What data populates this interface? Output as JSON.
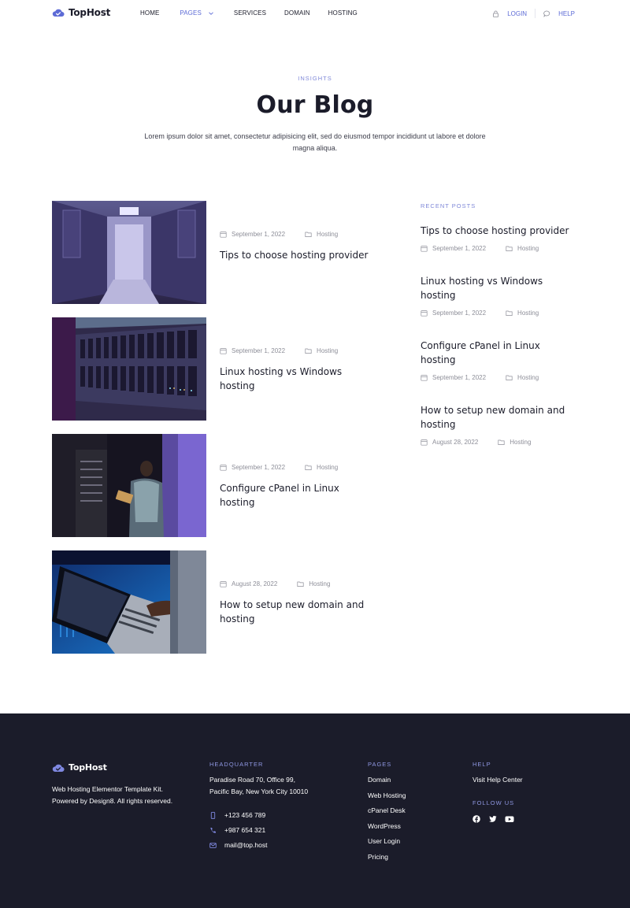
{
  "brand": {
    "name": "TopHost",
    "accent": "#5d6bd6",
    "dark": "#1b1c2a"
  },
  "nav": {
    "items": [
      {
        "label": "HOME"
      },
      {
        "label": "PAGES"
      },
      {
        "label": "SERVICES"
      },
      {
        "label": "DOMAIN"
      },
      {
        "label": "HOSTING"
      }
    ],
    "login_label": "LOGIN",
    "help_label": "HELP"
  },
  "hero": {
    "eyebrow": "INSIGHTS",
    "title": "Our Blog",
    "lead": "Lorem ipsum dolor sit amet, consectetur adipisicing elit, sed do eiusmod tempor incididunt ut labore et dolore magna aliqua."
  },
  "posts": [
    {
      "date": "September 1, 2022",
      "category": "Hosting",
      "title": "Tips to choose hosting provider",
      "image": "server-corridor"
    },
    {
      "date": "September 1, 2022",
      "category": "Hosting",
      "title": "Linux hosting vs Windows hosting",
      "image": "server-rack"
    },
    {
      "date": "September 1, 2022",
      "category": "Hosting",
      "title": "Configure cPanel in Linux hosting",
      "image": "engineer-tablet"
    },
    {
      "date": "August 28, 2022",
      "category": "Hosting",
      "title": "How to setup new domain and hosting",
      "image": "laptop-datacenter"
    }
  ],
  "sidebar": {
    "eyebrow": "RECENT POSTS",
    "posts": [
      {
        "title": "Tips to choose hosting provider",
        "date": "September 1, 2022",
        "category": "Hosting"
      },
      {
        "title": "Linux hosting vs Windows hosting",
        "date": "September 1, 2022",
        "category": "Hosting"
      },
      {
        "title": "Configure cPanel in Linux hosting",
        "date": "September 1, 2022",
        "category": "Hosting"
      },
      {
        "title": "How to setup new domain and hosting",
        "date": "August 28, 2022",
        "category": "Hosting"
      }
    ]
  },
  "footer": {
    "brand": "TopHost",
    "description": "Web Hosting Elementor Template Kit. Powered by Design8. All rights reserved.",
    "hq_title": "HEADQUARTER",
    "address_line1": "Paradise Road 70, Office 99,",
    "address_line2": "Pacific Bay,  New York City 10010",
    "phone1": "+123 456 789",
    "phone2": "+987 654 321",
    "email": "mail@top.host",
    "pages_title": "PAGES",
    "pages": [
      "Domain",
      "Web Hosting",
      "cPanel Desk",
      "WordPress",
      "User Login",
      "Pricing"
    ],
    "help_title": "HELP",
    "help_link": "Visit Help Center",
    "follow_title": "FOLLOW  US",
    "social_icons": [
      "facebook-icon",
      "twitter-icon",
      "youtube-icon"
    ]
  }
}
